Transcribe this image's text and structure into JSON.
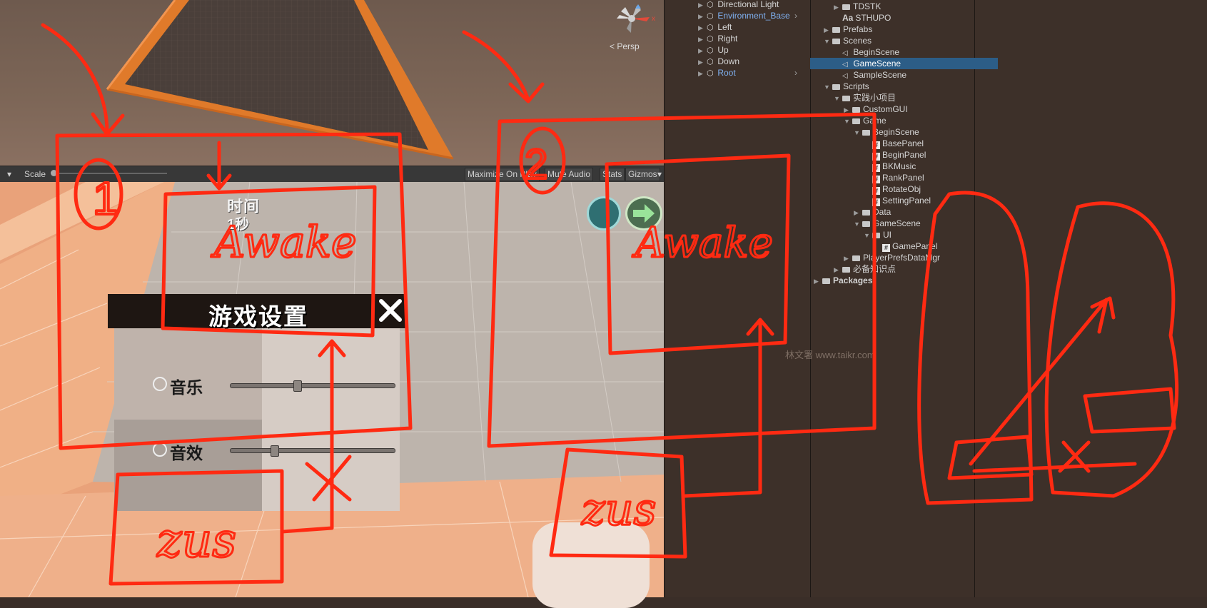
{
  "scene_view": {
    "persp_label": "< Persp",
    "gizmo_x": "x"
  },
  "game_toolbar": {
    "scale_label": "Scale",
    "buttons": [
      "Maximize On Play",
      "Mute Audio",
      "Stats",
      "Gizmos"
    ]
  },
  "game_view": {
    "time_label": "时间",
    "time_value": "1秒",
    "settings_panel": {
      "title": "游戏设置",
      "close_icon": "close-x-icon",
      "rows": [
        {
          "label": "音乐",
          "slider_value": 0.41
        },
        {
          "label": "音效",
          "slider_value": 0.27
        }
      ]
    }
  },
  "hierarchy": {
    "items": [
      {
        "label": "Directional Light",
        "blue": false,
        "more": false
      },
      {
        "label": "Environment_Base",
        "blue": true,
        "more": true
      },
      {
        "label": "Left",
        "blue": false,
        "more": false
      },
      {
        "label": "Right",
        "blue": false,
        "more": false
      },
      {
        "label": "Up",
        "blue": false,
        "more": false
      },
      {
        "label": "Down",
        "blue": false,
        "more": false
      },
      {
        "label": "Root",
        "blue": true,
        "more": true
      }
    ]
  },
  "project": {
    "items": [
      {
        "label": "TDSTK",
        "type": "folder",
        "indent": 2,
        "arrow": "▶"
      },
      {
        "label": "STHUPO",
        "type": "font",
        "indent": 2,
        "arrow": ""
      },
      {
        "label": "Prefabs",
        "type": "folder",
        "indent": 1,
        "arrow": "▶"
      },
      {
        "label": "Scenes",
        "type": "folder",
        "indent": 1,
        "arrow": "▼"
      },
      {
        "label": "BeginScene",
        "type": "scene",
        "indent": 2,
        "arrow": ""
      },
      {
        "label": "GameScene",
        "type": "scene",
        "indent": 2,
        "arrow": "",
        "selected": true
      },
      {
        "label": "SampleScene",
        "type": "scene",
        "indent": 2,
        "arrow": ""
      },
      {
        "label": "Scripts",
        "type": "folder",
        "indent": 1,
        "arrow": "▼"
      },
      {
        "label": "实践小项目",
        "type": "folder",
        "indent": 2,
        "arrow": "▼"
      },
      {
        "label": "CustomGUI",
        "type": "folder",
        "indent": 3,
        "arrow": "▶"
      },
      {
        "label": "Game",
        "type": "folder",
        "indent": 3,
        "arrow": "▼"
      },
      {
        "label": "BeginScene",
        "type": "folder",
        "indent": 4,
        "arrow": "▼"
      },
      {
        "label": "BasePanel",
        "type": "script",
        "indent": 5,
        "arrow": ""
      },
      {
        "label": "BeginPanel",
        "type": "script",
        "indent": 5,
        "arrow": ""
      },
      {
        "label": "BKMusic",
        "type": "script",
        "indent": 5,
        "arrow": ""
      },
      {
        "label": "RankPanel",
        "type": "script",
        "indent": 5,
        "arrow": ""
      },
      {
        "label": "RotateObj",
        "type": "script",
        "indent": 5,
        "arrow": ""
      },
      {
        "label": "SettingPanel",
        "type": "script",
        "indent": 5,
        "arrow": ""
      },
      {
        "label": "Data",
        "type": "folder",
        "indent": 4,
        "arrow": "▶"
      },
      {
        "label": "GameScene",
        "type": "folder",
        "indent": 4,
        "arrow": "▼"
      },
      {
        "label": "UI",
        "type": "folder",
        "indent": 5,
        "arrow": "▼"
      },
      {
        "label": "GamePanel",
        "type": "script",
        "indent": 6,
        "arrow": ""
      },
      {
        "label": "PlayerPrefsDataMgr",
        "type": "folder",
        "indent": 3,
        "arrow": "▶"
      },
      {
        "label": "必备知识点",
        "type": "folder",
        "indent": 2,
        "arrow": "▶"
      },
      {
        "label": "Packages",
        "type": "folder",
        "indent": 0,
        "arrow": "▶",
        "bold": true
      }
    ]
  },
  "watermark": "林文署 www.taikr.com",
  "annotations": {
    "label_1": "1",
    "label_2": "2",
    "awake_1": "Awake",
    "awake_2": "Awake",
    "zus_1": "zus",
    "zus_2": "zus",
    "color": "#ff2a12"
  },
  "colors": {
    "selection": "#2c5d87",
    "panel_header": "#1e1612",
    "annotation_red": "#ff2a12"
  }
}
